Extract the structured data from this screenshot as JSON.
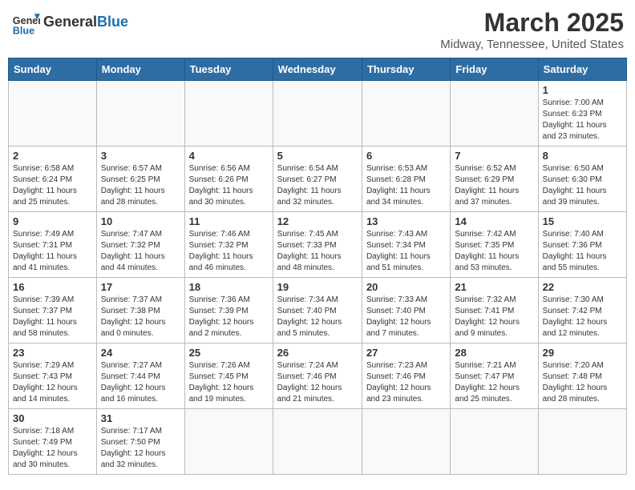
{
  "header": {
    "logo_general": "General",
    "logo_blue": "Blue",
    "month_title": "March 2025",
    "location": "Midway, Tennessee, United States"
  },
  "weekdays": [
    "Sunday",
    "Monday",
    "Tuesday",
    "Wednesday",
    "Thursday",
    "Friday",
    "Saturday"
  ],
  "weeks": [
    [
      {
        "day": "",
        "info": ""
      },
      {
        "day": "",
        "info": ""
      },
      {
        "day": "",
        "info": ""
      },
      {
        "day": "",
        "info": ""
      },
      {
        "day": "",
        "info": ""
      },
      {
        "day": "",
        "info": ""
      },
      {
        "day": "1",
        "info": "Sunrise: 7:00 AM\nSunset: 6:23 PM\nDaylight: 11 hours\nand 23 minutes."
      }
    ],
    [
      {
        "day": "2",
        "info": "Sunrise: 6:58 AM\nSunset: 6:24 PM\nDaylight: 11 hours\nand 25 minutes."
      },
      {
        "day": "3",
        "info": "Sunrise: 6:57 AM\nSunset: 6:25 PM\nDaylight: 11 hours\nand 28 minutes."
      },
      {
        "day": "4",
        "info": "Sunrise: 6:56 AM\nSunset: 6:26 PM\nDaylight: 11 hours\nand 30 minutes."
      },
      {
        "day": "5",
        "info": "Sunrise: 6:54 AM\nSunset: 6:27 PM\nDaylight: 11 hours\nand 32 minutes."
      },
      {
        "day": "6",
        "info": "Sunrise: 6:53 AM\nSunset: 6:28 PM\nDaylight: 11 hours\nand 34 minutes."
      },
      {
        "day": "7",
        "info": "Sunrise: 6:52 AM\nSunset: 6:29 PM\nDaylight: 11 hours\nand 37 minutes."
      },
      {
        "day": "8",
        "info": "Sunrise: 6:50 AM\nSunset: 6:30 PM\nDaylight: 11 hours\nand 39 minutes."
      }
    ],
    [
      {
        "day": "9",
        "info": "Sunrise: 7:49 AM\nSunset: 7:31 PM\nDaylight: 11 hours\nand 41 minutes."
      },
      {
        "day": "10",
        "info": "Sunrise: 7:47 AM\nSunset: 7:32 PM\nDaylight: 11 hours\nand 44 minutes."
      },
      {
        "day": "11",
        "info": "Sunrise: 7:46 AM\nSunset: 7:32 PM\nDaylight: 11 hours\nand 46 minutes."
      },
      {
        "day": "12",
        "info": "Sunrise: 7:45 AM\nSunset: 7:33 PM\nDaylight: 11 hours\nand 48 minutes."
      },
      {
        "day": "13",
        "info": "Sunrise: 7:43 AM\nSunset: 7:34 PM\nDaylight: 11 hours\nand 51 minutes."
      },
      {
        "day": "14",
        "info": "Sunrise: 7:42 AM\nSunset: 7:35 PM\nDaylight: 11 hours\nand 53 minutes."
      },
      {
        "day": "15",
        "info": "Sunrise: 7:40 AM\nSunset: 7:36 PM\nDaylight: 11 hours\nand 55 minutes."
      }
    ],
    [
      {
        "day": "16",
        "info": "Sunrise: 7:39 AM\nSunset: 7:37 PM\nDaylight: 11 hours\nand 58 minutes."
      },
      {
        "day": "17",
        "info": "Sunrise: 7:37 AM\nSunset: 7:38 PM\nDaylight: 12 hours\nand 0 minutes."
      },
      {
        "day": "18",
        "info": "Sunrise: 7:36 AM\nSunset: 7:39 PM\nDaylight: 12 hours\nand 2 minutes."
      },
      {
        "day": "19",
        "info": "Sunrise: 7:34 AM\nSunset: 7:40 PM\nDaylight: 12 hours\nand 5 minutes."
      },
      {
        "day": "20",
        "info": "Sunrise: 7:33 AM\nSunset: 7:40 PM\nDaylight: 12 hours\nand 7 minutes."
      },
      {
        "day": "21",
        "info": "Sunrise: 7:32 AM\nSunset: 7:41 PM\nDaylight: 12 hours\nand 9 minutes."
      },
      {
        "day": "22",
        "info": "Sunrise: 7:30 AM\nSunset: 7:42 PM\nDaylight: 12 hours\nand 12 minutes."
      }
    ],
    [
      {
        "day": "23",
        "info": "Sunrise: 7:29 AM\nSunset: 7:43 PM\nDaylight: 12 hours\nand 14 minutes."
      },
      {
        "day": "24",
        "info": "Sunrise: 7:27 AM\nSunset: 7:44 PM\nDaylight: 12 hours\nand 16 minutes."
      },
      {
        "day": "25",
        "info": "Sunrise: 7:26 AM\nSunset: 7:45 PM\nDaylight: 12 hours\nand 19 minutes."
      },
      {
        "day": "26",
        "info": "Sunrise: 7:24 AM\nSunset: 7:46 PM\nDaylight: 12 hours\nand 21 minutes."
      },
      {
        "day": "27",
        "info": "Sunrise: 7:23 AM\nSunset: 7:46 PM\nDaylight: 12 hours\nand 23 minutes."
      },
      {
        "day": "28",
        "info": "Sunrise: 7:21 AM\nSunset: 7:47 PM\nDaylight: 12 hours\nand 25 minutes."
      },
      {
        "day": "29",
        "info": "Sunrise: 7:20 AM\nSunset: 7:48 PM\nDaylight: 12 hours\nand 28 minutes."
      }
    ],
    [
      {
        "day": "30",
        "info": "Sunrise: 7:18 AM\nSunset: 7:49 PM\nDaylight: 12 hours\nand 30 minutes."
      },
      {
        "day": "31",
        "info": "Sunrise: 7:17 AM\nSunset: 7:50 PM\nDaylight: 12 hours\nand 32 minutes."
      },
      {
        "day": "",
        "info": ""
      },
      {
        "day": "",
        "info": ""
      },
      {
        "day": "",
        "info": ""
      },
      {
        "day": "",
        "info": ""
      },
      {
        "day": "",
        "info": ""
      }
    ]
  ]
}
